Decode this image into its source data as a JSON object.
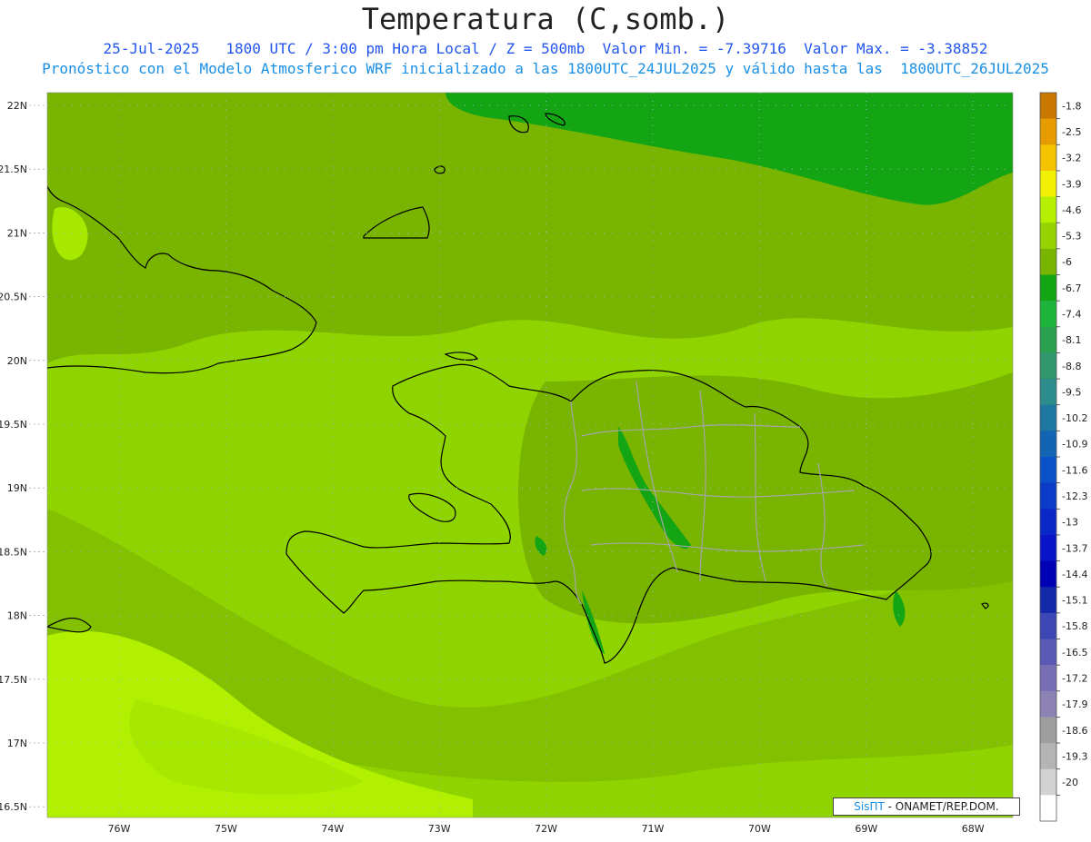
{
  "header": {
    "title": "Temperatura (C,somb.)",
    "line1": "25-Jul-2025   1800 UTC / 3:00 pm Hora Local / Z = 500mb  Valor Min. = -7.39716  Valor Max. = -3.38852",
    "line2": "Pronóstico con el Modelo Atmosferico WRF inicializado a las 1800UTC_24JUL2025 y válido hasta las  1800UTC_26JUL2025"
  },
  "axes": {
    "lat_labels": [
      "22N",
      "21.5N",
      "21N",
      "20.5N",
      "20N",
      "19.5N",
      "19N",
      "18.5N",
      "18N",
      "17.5N",
      "17N",
      "16.5N"
    ],
    "lon_labels": [
      "76W",
      "75W",
      "74W",
      "73W",
      "72W",
      "71W",
      "70W",
      "69W",
      "68W"
    ]
  },
  "colorbar": {
    "labels": [
      "-1.8",
      "-2.5",
      "-3.2",
      "-3.9",
      "-4.6",
      "-5.3",
      "-6",
      "-6.7",
      "-7.4",
      "-8.1",
      "-8.8",
      "-9.5",
      "-10.2",
      "-10.9",
      "-11.6",
      "-12.3",
      "-13",
      "-13.7",
      "-14.4",
      "-15.1",
      "-15.8",
      "-16.5",
      "-17.2",
      "-17.9",
      "-18.6",
      "-19.3",
      "-20"
    ],
    "colors": [
      "#c87800",
      "#e69b00",
      "#f5c200",
      "#f0f000",
      "#b4f000",
      "#96d200",
      "#78b400",
      "#14a514",
      "#1eb43c",
      "#28a050",
      "#32966e",
      "#2d8c8c",
      "#1e78a0",
      "#1464b4",
      "#0a50c8",
      "#0a3cc8",
      "#0a28c8",
      "#0a14c8",
      "#0000b4",
      "#1428aa",
      "#3c46b4",
      "#5a5ab4",
      "#786eb4",
      "#8c82b4",
      "#9e9e9e",
      "#b4b4b4",
      "#d2d2d2",
      "#ffffff"
    ]
  },
  "map": {
    "ocean_color": "#8fd400",
    "warm_color": "#b0f000",
    "cool_color": "#78b400",
    "coldest_color": "#14a514"
  },
  "credit": {
    "brand": "SisПT",
    "text": " - ONAMET/REP.DOM."
  }
}
